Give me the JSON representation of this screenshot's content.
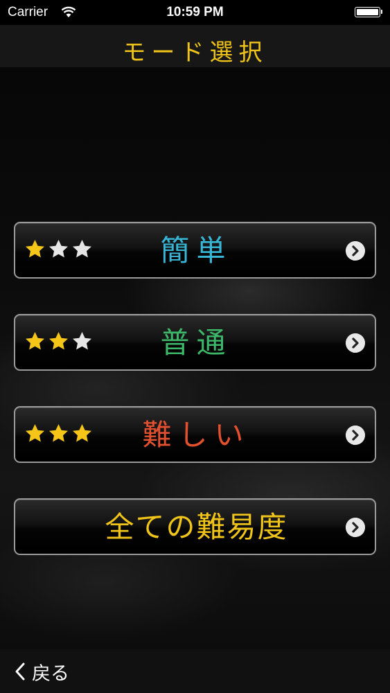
{
  "status_bar": {
    "carrier": "Carrier",
    "time": "10:59 PM"
  },
  "nav": {
    "title": "モード選択"
  },
  "modes": [
    {
      "label": "簡単",
      "stars_filled": 1,
      "stars_total": 3,
      "color": "#37b6d6"
    },
    {
      "label": "普通",
      "stars_filled": 2,
      "stars_total": 3,
      "color": "#3db86a"
    },
    {
      "label": "難しい",
      "stars_filled": 3,
      "stars_total": 3,
      "color": "#e2502f"
    },
    {
      "label": "全ての難易度",
      "stars_filled": 0,
      "stars_total": 0,
      "color": "#f0c419"
    }
  ],
  "bottom": {
    "back_label": "戻る"
  },
  "colors": {
    "star_filled": "#f5c518",
    "star_empty": "#e6e6e6",
    "title": "#f0c419"
  }
}
